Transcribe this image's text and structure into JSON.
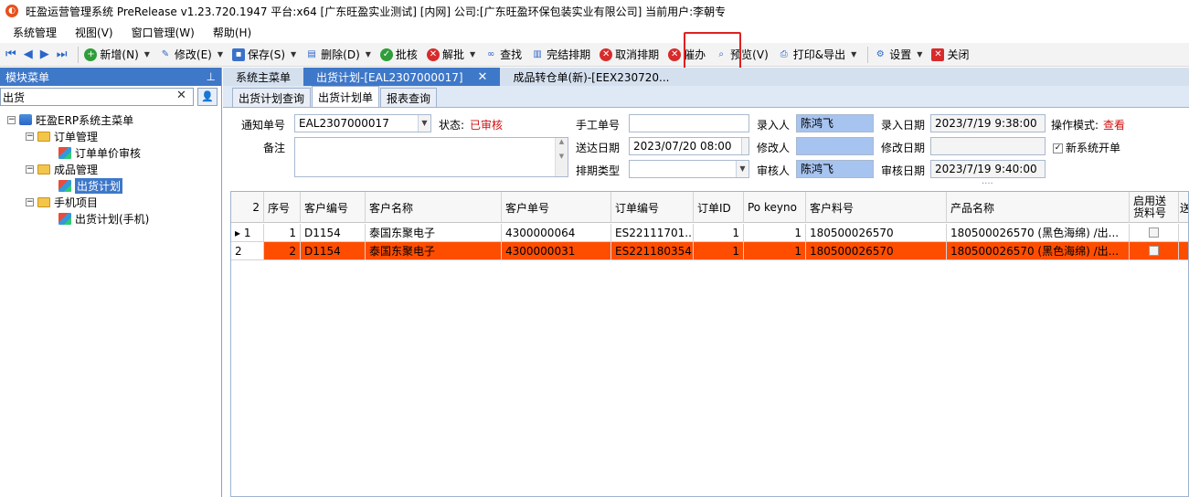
{
  "window": {
    "title": "旺盈运营管理系统 PreRelease v1.23.720.1947 平台:x64  [广东旺盈实业测试] [内网] 公司:[广东旺盈环保包装实业有限公司] 当前用户:李朝专"
  },
  "menubar": {
    "items": [
      "系统管理",
      "视图(V)",
      "窗口管理(W)",
      "帮助(H)"
    ]
  },
  "toolbar": {
    "new": "新增(N)",
    "edit": "修改(E)",
    "save": "保存(S)",
    "delete": "删除(D)",
    "approve": "批核",
    "unapprove": "解批",
    "search": "查找",
    "finish_schedule": "完结排期",
    "cancel_schedule": "取消排期",
    "urge": "催办",
    "preview": "预览(V)",
    "print_export": "打印&导出",
    "settings": "设置",
    "close": "关闭"
  },
  "left_panel": {
    "title": "模块菜单",
    "pin": "ᵖ",
    "search_value": "出货",
    "tree": {
      "root": "旺盈ERP系统主菜单",
      "order_mgmt": "订单管理",
      "order_price_review": "订单单价审核",
      "product_mgmt": "成品管理",
      "shipping_plan": "出货计划",
      "mobile_project": "手机项目",
      "shipping_plan_mobile": "出货计划(手机)"
    }
  },
  "doc_tabs": {
    "main_menu": "系统主菜单",
    "shipping_plan": "出货计划-[EAL2307000017]",
    "transfer": "成品转仓单(新)-[EEX230720..."
  },
  "sub_tabs": {
    "query": "出货计划查询",
    "form": "出货计划单",
    "report": "报表查询"
  },
  "form": {
    "notice_no_label": "通知单号",
    "notice_no": "EAL2307000017",
    "status_label": "状态:",
    "status": "已审核",
    "remark_label": "备注",
    "manual_no_label": "手工单号",
    "manual_no": "",
    "delivery_date_label": "送达日期",
    "delivery_date": "2023/07/20 08:00",
    "schedule_type_label": "排期类型",
    "schedule_type": "",
    "entered_by_label": "录入人",
    "entered_by": "陈鸿飞",
    "modified_by_label": "修改人",
    "modified_by": "",
    "reviewer_label": "审核人",
    "reviewer": "陈鸿飞",
    "entry_date_label": "录入日期",
    "entry_date": "2023/7/19 9:38:00",
    "modify_date_label": "修改日期",
    "modify_date": "",
    "review_date_label": "审核日期",
    "review_date": "2023/7/19 9:40:00",
    "mode_label": "操作模式:",
    "mode": "查看",
    "new_system_label": "新系统开单",
    "new_system_checked": true
  },
  "grid": {
    "row_count": "2",
    "columns": [
      "序号",
      "客户编号",
      "客户名称",
      "客户单号",
      "订单编号",
      "订单ID",
      "Po keyno",
      "客户料号",
      "产品名称",
      "启用送货料号",
      "送"
    ],
    "rows": [
      {
        "indicator": "▸ 1",
        "seq": "1",
        "cust_code": "D1154",
        "cust_name": "泰国东聚电子",
        "cust_order": "4300000064",
        "order_no": "ES22111701...",
        "order_id": "1",
        "po_keyno": "1",
        "cust_part": "180500026570",
        "product": "180500026570 (黑色海绵) /出..."
      },
      {
        "indicator": "2",
        "seq": "2",
        "cust_code": "D1154",
        "cust_name": "泰国东聚电子",
        "cust_order": "4300000031",
        "order_no": "ES221180354",
        "order_id": "1",
        "po_keyno": "1",
        "cust_part": "180500026570",
        "product": "180500026570 (黑色海绵) /出..."
      }
    ]
  },
  "colors": {
    "accent": "#3e78c9",
    "highlight_row": "#ff4d00",
    "annotation": "#e02020"
  }
}
